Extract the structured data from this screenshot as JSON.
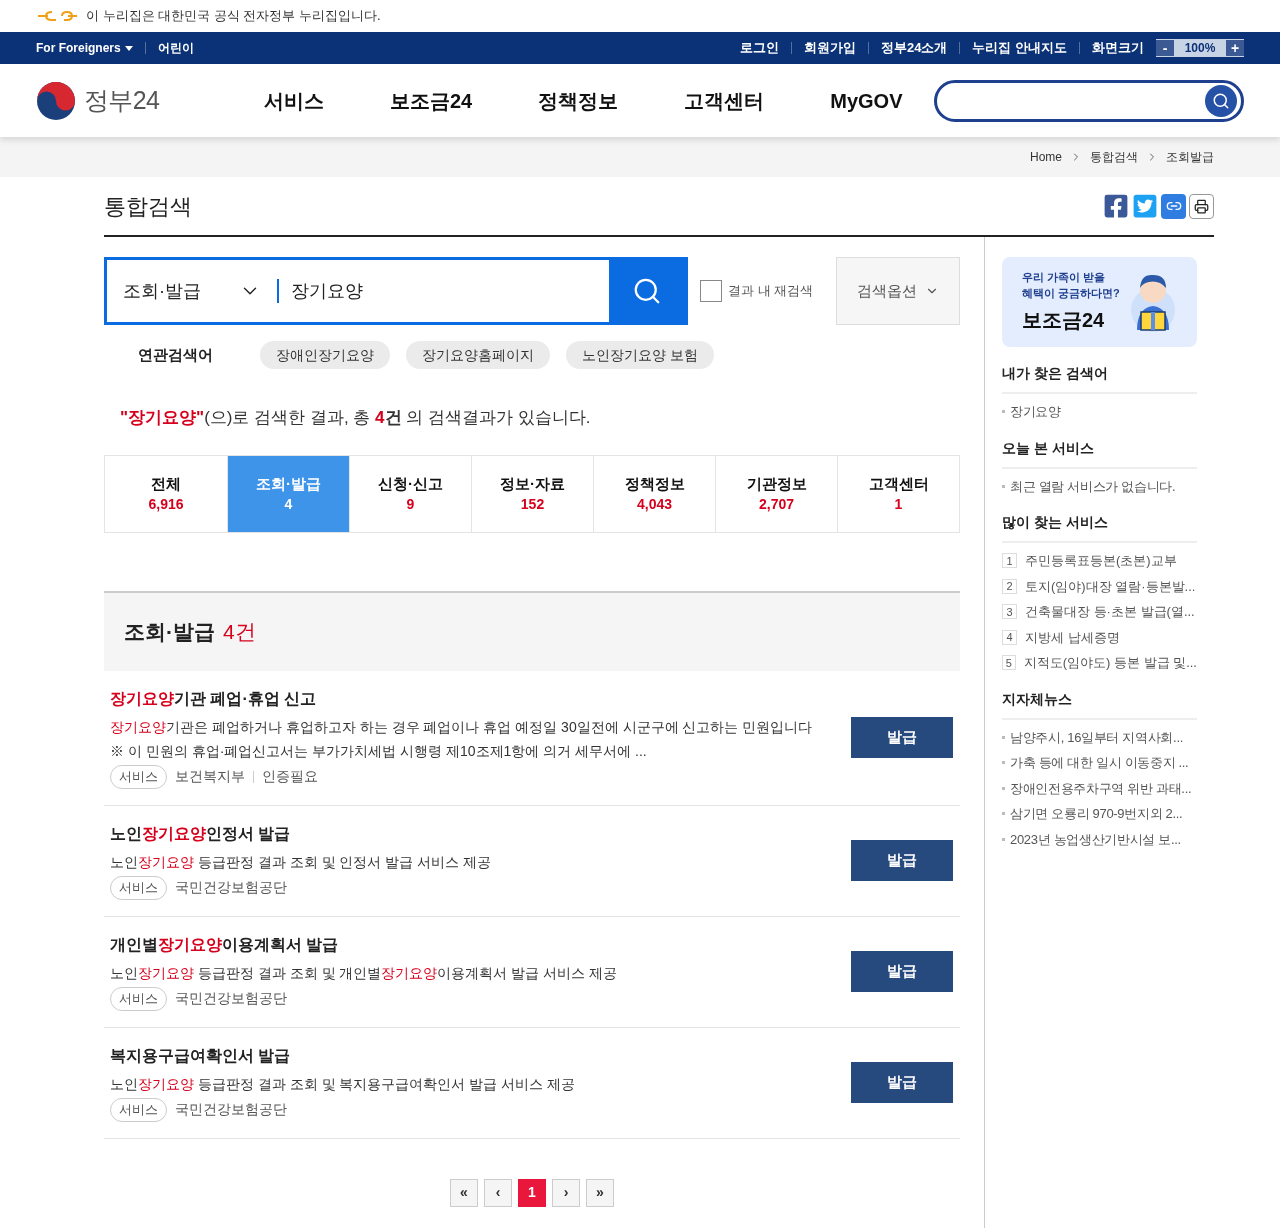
{
  "notice": {
    "text": "이 누리집은 대한민국 공식 전자정부 누리집입니다."
  },
  "topnav": {
    "left": [
      {
        "label": "For Foreigners",
        "dropdown": true
      },
      {
        "label": "어린이",
        "dropdown": false
      }
    ],
    "right": [
      "로그인",
      "회원가입",
      "정부24소개",
      "누리집 안내지도"
    ],
    "zoom": {
      "label": "화면크기",
      "minus": "-",
      "value": "100%",
      "plus": "+"
    }
  },
  "header": {
    "logo_text": "정부24",
    "menu": [
      "서비스",
      "보조금24",
      "정책정보",
      "고객센터",
      "MyGOV"
    ]
  },
  "breadcrumb": [
    "Home",
    "통합검색",
    "조회발급"
  ],
  "page_title": "통합검색",
  "search": {
    "category": "조회·발급",
    "query": "장기요양",
    "recheck": {
      "label": "결과 내 재검색",
      "checked": false
    },
    "options_button": "검색옵션"
  },
  "related": {
    "label": "연관검색어",
    "tags": [
      "장애인장기요양",
      "장기요양홈페이지",
      "노인장기요양 보험"
    ]
  },
  "summary": [
    {
      "text": "\"장기요양\"",
      "kind": "highlight"
    },
    {
      "text": "(으)로 검색한 결과, 총 ",
      "kind": "plain"
    },
    {
      "text": "4",
      "kind": "highlight"
    },
    {
      "text": "건",
      "kind": "strong"
    },
    {
      "text": " 의 검색결과가 있습니다.",
      "kind": "plain"
    }
  ],
  "tabs": [
    {
      "label": "전체",
      "count": "6,916",
      "selected": false
    },
    {
      "label": "조회·발급",
      "count": "4",
      "selected": true
    },
    {
      "label": "신청·신고",
      "count": "9",
      "selected": false
    },
    {
      "label": "정보·자료",
      "count": "152",
      "selected": false
    },
    {
      "label": "정책정보",
      "count": "4,043",
      "selected": false
    },
    {
      "label": "기관정보",
      "count": "2,707",
      "selected": false
    },
    {
      "label": "고객센터",
      "count": "1",
      "selected": false
    }
  ],
  "section": {
    "title": "조회·발급",
    "count": "4건"
  },
  "results": [
    {
      "title": [
        {
          "text": "장기요양",
          "kind": "highlight"
        },
        {
          "text": "기관 폐업·휴업 신고",
          "kind": "plain"
        }
      ],
      "desc": [
        {
          "text": "장기요양",
          "kind": "highlight"
        },
        {
          "text": "기관은 폐업하거나 휴업하고자 하는 경우 폐업이나 휴업 예정일 30일전에 시군구에 신고하는 민원입니다 ※ 이 민원의 휴업·폐업신고서는 부가가치세법 시행령 제10조제1항에 의거 세무서에 ...",
          "kind": "plain"
        }
      ],
      "tag": "서비스",
      "meta": [
        "보건복지부",
        "인증필요"
      ],
      "button": "발급"
    },
    {
      "title": [
        {
          "text": "노인",
          "kind": "plain"
        },
        {
          "text": "장기요양",
          "kind": "highlight"
        },
        {
          "text": "인정서 발급",
          "kind": "plain"
        }
      ],
      "desc": [
        {
          "text": "노인",
          "kind": "plain"
        },
        {
          "text": "장기요양",
          "kind": "highlight"
        },
        {
          "text": " 등급판정 결과 조회 및 인정서 발급 서비스 제공",
          "kind": "plain"
        }
      ],
      "tag": "서비스",
      "meta": [
        "국민건강보험공단"
      ],
      "button": "발급"
    },
    {
      "title": [
        {
          "text": "개인별",
          "kind": "plain"
        },
        {
          "text": "장기요양",
          "kind": "highlight"
        },
        {
          "text": "이용계획서 발급",
          "kind": "plain"
        }
      ],
      "desc": [
        {
          "text": "노인",
          "kind": "plain"
        },
        {
          "text": "장기요양",
          "kind": "highlight"
        },
        {
          "text": " 등급판정 결과 조회 및 개인별",
          "kind": "plain"
        },
        {
          "text": "장기요양",
          "kind": "highlight"
        },
        {
          "text": "이용계획서 발급 서비스 제공",
          "kind": "plain"
        }
      ],
      "tag": "서비스",
      "meta": [
        "국민건강보험공단"
      ],
      "button": "발급"
    },
    {
      "title": [
        {
          "text": "복지용구급여확인서 발급",
          "kind": "plain"
        }
      ],
      "desc": [
        {
          "text": "노인",
          "kind": "plain"
        },
        {
          "text": "장기요양",
          "kind": "highlight"
        },
        {
          "text": " 등급판정 결과 조회 및 복지용구급여확인서 발급 서비스 제공",
          "kind": "plain"
        }
      ],
      "tag": "서비스",
      "meta": [
        "국민건강보험공단"
      ],
      "button": "발급"
    }
  ],
  "pagination": [
    {
      "label": "«",
      "selected": false
    },
    {
      "label": "‹",
      "selected": false
    },
    {
      "label": "1",
      "selected": true
    },
    {
      "label": "›",
      "selected": false
    },
    {
      "label": "»",
      "selected": false
    }
  ],
  "sidebar": {
    "banner": {
      "lines": [
        "우리 가족이 받을",
        "혜택이 궁금하다면?"
      ],
      "title": "보조금24"
    },
    "sections": [
      {
        "title": "내가 찾은 검색어",
        "kind": "bullet",
        "items": [
          "장기요양"
        ]
      },
      {
        "title": "오늘 본 서비스",
        "kind": "bullet",
        "items": [
          "최근 열람 서비스가 없습니다."
        ]
      },
      {
        "title": "많이 찾는 서비스",
        "kind": "ranked",
        "items": [
          {
            "rank": "1",
            "text": "주민등록표등본(초본)교부"
          },
          {
            "rank": "2",
            "text": "토지(임야)대장 열람·등본발..."
          },
          {
            "rank": "3",
            "text": "건축물대장 등·초본 발급(열..."
          },
          {
            "rank": "4",
            "text": "지방세 납세증명"
          },
          {
            "rank": "5",
            "text": "지적도(임야도) 등본 발급 및..."
          }
        ]
      },
      {
        "title": "지자체뉴스",
        "kind": "bullet",
        "items": [
          "남양주시, 16일부터 지역사회...",
          "가축 등에 대한 일시 이동중지 ...",
          "장애인전용주차구역 위반 과태...",
          "삼기면 오룡리 970-9번지외 2...",
          "2023년 농업생산기반시설 보..."
        ]
      }
    ]
  }
}
